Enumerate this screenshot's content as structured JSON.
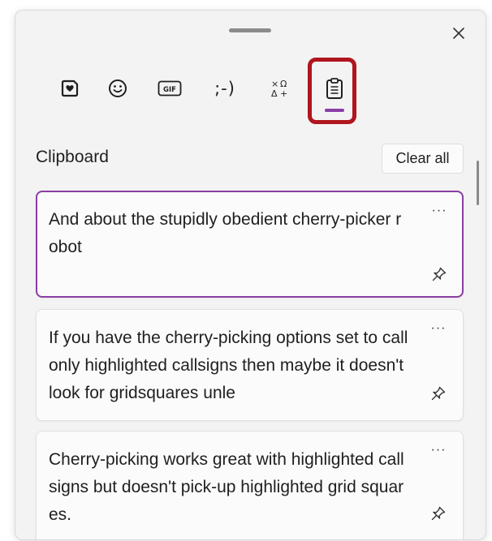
{
  "panel": {
    "close_icon": "close-icon",
    "drag_handle_icon": "drag-handle"
  },
  "tabs": [
    {
      "name": "Stickers",
      "icon": "heart-sticker-icon"
    },
    {
      "name": "Emoji",
      "icon": "smiley-icon"
    },
    {
      "name": "GIF",
      "icon": "gif-icon",
      "text": "GIF"
    },
    {
      "name": "Kaomoji",
      "text": ";-)"
    },
    {
      "name": "Symbols",
      "icon": "symbols-icon"
    },
    {
      "name": "Clipboard history",
      "icon": "clipboard-icon",
      "selected": true
    }
  ],
  "colors": {
    "accent": "#8a3ea6",
    "highlight_box": "#b0151e",
    "panel_bg": "#f3f3f3",
    "card_bg": "#fbfbfb"
  },
  "clipboard": {
    "title": "Clipboard",
    "clear_all_label": "Clear all",
    "more_label": "···",
    "items": [
      {
        "text": "And about the stupidly obedient cherry-picker robot",
        "selected": true
      },
      {
        "text": "If you have the cherry-picking options set to call only highlighted callsigns then maybe it doesn't look for gridsquares unle",
        "selected": false
      },
      {
        "text": "Cherry-picking works great with highlighted call signs but doesn't pick-up highlighted grid squares.",
        "selected": false
      }
    ]
  }
}
